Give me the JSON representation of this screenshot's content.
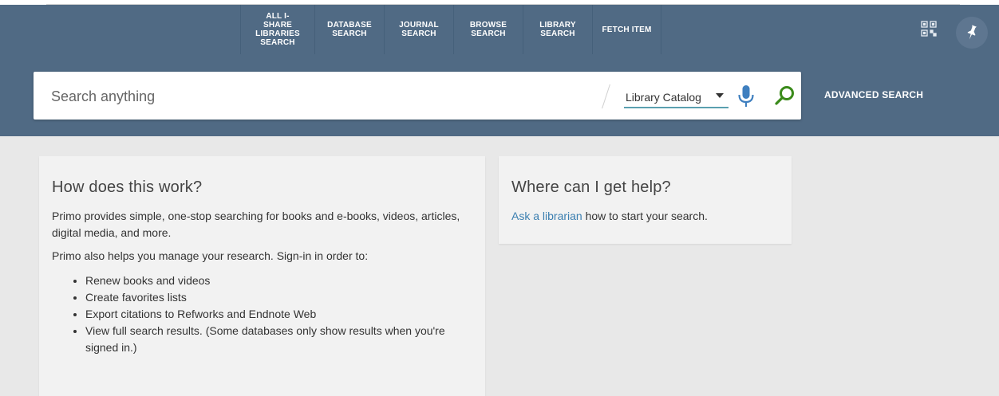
{
  "nav": {
    "items": [
      {
        "label": "ALL I-SHARE LIBRARIES SEARCH"
      },
      {
        "label": "DATABASE SEARCH"
      },
      {
        "label": "JOURNAL SEARCH"
      },
      {
        "label": "BROWSE SEARCH"
      },
      {
        "label": "LIBRARY SEARCH"
      },
      {
        "label": "FETCH ITEM"
      }
    ]
  },
  "icons": {
    "qr": "qr-code-icon",
    "pin": "pin-icon",
    "mic": "microphone-icon",
    "search": "magnifier-icon"
  },
  "search": {
    "placeholder": "Search anything",
    "scope": "Library Catalog",
    "advanced": "ADVANCED SEARCH"
  },
  "colors": {
    "navbar": "#506a84",
    "accent_mic": "#3f7fbf",
    "accent_search": "#3a8a1a",
    "link": "#3b7fb0"
  },
  "how": {
    "title": "How does this work?",
    "p1": "Primo provides simple, one-stop searching for books and e-books, videos, articles, digital media, and more.",
    "p2": "Primo also helps you manage your research. Sign-in in order to:",
    "bullets": [
      "Renew books and videos",
      "Create favorites lists",
      "Export citations to Refworks and Endnote Web",
      "View full search results. (Some databases only show results when you're signed in.)"
    ]
  },
  "help": {
    "title": "Where can I get help?",
    "link": "Ask a librarian",
    "rest": " how to start your search."
  }
}
